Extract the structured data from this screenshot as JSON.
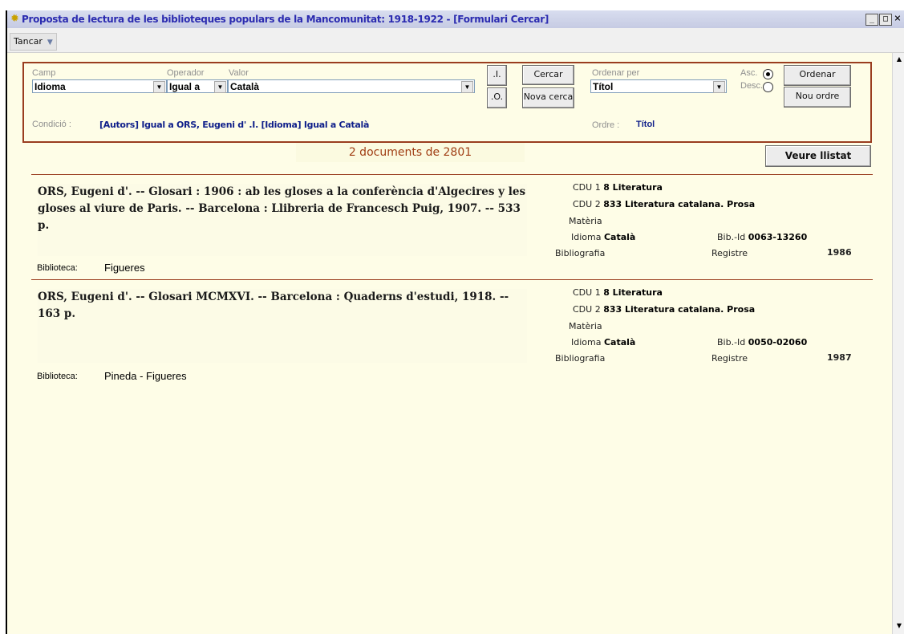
{
  "window": {
    "title": "Proposta de lectura de les biblioteques populars de la Mancomunitat: 1918-1922 - [Formulari Cercar]",
    "controls": [
      "_",
      "□",
      "×"
    ]
  },
  "menu": {
    "tancar": "Tancar"
  },
  "search": {
    "camp_label": "Camp",
    "operador_label": "Operador",
    "valor_label": "Valor",
    "camp_value": "Idioma",
    "operador_value": "Igual a",
    "valor_value": "Català",
    "and_button": ".I.",
    "or_button": ".O.",
    "cercar_button": "Cercar",
    "nova_cerca_button": "Nova cerca",
    "ordenar_per_label": "Ordenar per",
    "ordenar_per_value": "Títol",
    "asc_label": "Asc.",
    "desc_label": "Desc.",
    "sort_selected": "Asc.",
    "ordenar_button": "Ordenar",
    "nou_ordre_button": "Nou ordre",
    "condicio_label": "Condició :",
    "condicio_value": "[Autors] Igual a ORS, Eugeni d' .I. [Idioma] Igual a Català",
    "ordre_label": "Ordre :",
    "ordre_value": "Títol"
  },
  "results": {
    "count_text": "2 documents de 2801",
    "veure_llistat": "Veure llistat",
    "records": [
      {
        "description": "ORS, Eugeni d'.  -- Glosari : 1906 : ab les gloses a la conferència d'Algecires y les gloses al viure de Paris. -- Barcelona : Llibreria de Francesch Puig, 1907. -- 533 p.",
        "biblioteca_label": "Biblioteca:",
        "biblioteca": "Figueres",
        "cdu1_label": "CDU 1",
        "cdu1": "8 Literatura",
        "cdu2_label": "CDU 2",
        "cdu2": "833 Literatura catalana. Prosa",
        "materia_label": "Matèria",
        "idioma_label": "Idioma",
        "idioma": "Català",
        "bibid_label": "Bib.-Id",
        "bibid": "0063-13260",
        "bibliografia_label": "Bibliografia",
        "registre_label": "Registre",
        "registre": "1986"
      },
      {
        "description": "ORS, Eugeni d'.  -- Glosari MCMXVI. -- Barcelona : Quaderns d'estudi, 1918. -- 163 p.",
        "biblioteca_label": "Biblioteca:",
        "biblioteca": "Pineda - Figueres",
        "cdu1_label": "CDU 1",
        "cdu1": "8 Literatura",
        "cdu2_label": "CDU 2",
        "cdu2": "833 Literatura catalana. Prosa",
        "materia_label": "Matèria",
        "idioma_label": "Idioma",
        "idioma": "Català",
        "bibid_label": "Bib.-Id",
        "bibid": "0050-02060",
        "bibliografia_label": "Bibliografia",
        "registre_label": "Registre",
        "registre": "1987"
      }
    ]
  },
  "colors": {
    "accent_border": "#9a3d1f",
    "title_text": "#2b2bb0",
    "condition_text": "#0f1f8a",
    "count_text": "#a03e14",
    "background": "#fefde7"
  }
}
